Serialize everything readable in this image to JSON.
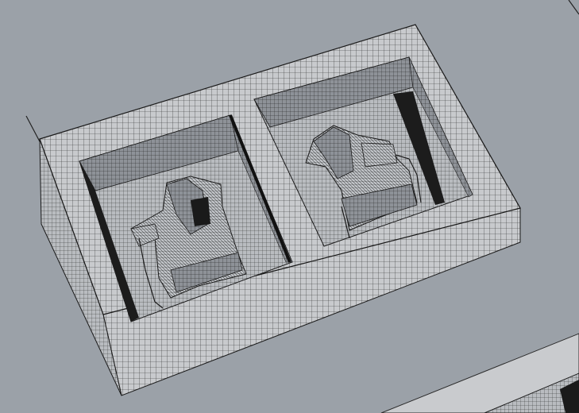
{
  "viewport": {
    "background_color": "#9ba1a8",
    "mesh_fill_color": "#c8cacd",
    "mesh_line_color": "#2a2a2a",
    "shadow_color": "#1a1a1a"
  },
  "scene": {
    "objects": [
      {
        "name": "mold-block",
        "icon": "mesh-box-icon"
      },
      {
        "name": "left-cavity",
        "icon": "mesh-cavity-icon"
      },
      {
        "name": "right-cavity",
        "icon": "mesh-cavity-icon"
      },
      {
        "name": "left-part",
        "icon": "mesh-part-icon"
      },
      {
        "name": "right-part",
        "icon": "mesh-part-icon"
      },
      {
        "name": "bottom-right-object",
        "icon": "mesh-box-icon"
      }
    ]
  }
}
